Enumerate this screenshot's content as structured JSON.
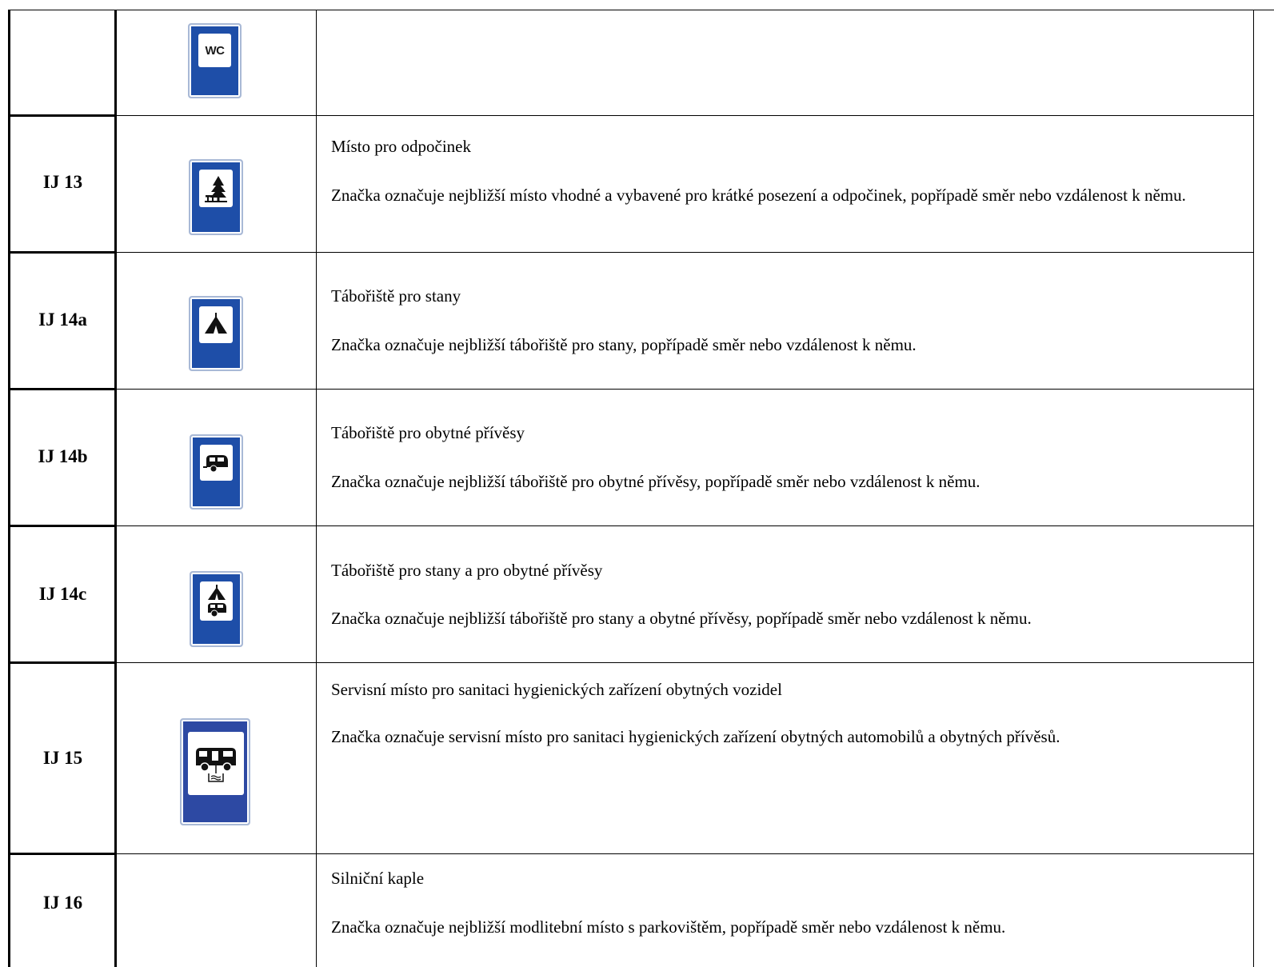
{
  "rows": [
    {
      "code": "",
      "sign_icon": "wc-icon",
      "sign_text": "WC",
      "title": "",
      "description": ""
    },
    {
      "code": "IJ 13",
      "sign_icon": "rest-area-icon",
      "title": "Místo pro odpočinek",
      "description": "Značka označuje nejbližší místo vhodné a vybavené pro krátké posezení a odpočinek, popřípadě směr nebo vzdálenost k němu."
    },
    {
      "code": "IJ 14a",
      "sign_icon": "tent-icon",
      "title": "Tábořiště pro stany",
      "description": "Značka označuje nejbližší tábořiště pro stany, popřípadě směr nebo vzdálenost k němu."
    },
    {
      "code": "IJ 14b",
      "sign_icon": "caravan-icon",
      "title": "Tábořiště pro obytné přívěsy",
      "description": "Značka označuje nejbližší tábořiště pro obytné přívěsy, popřípadě směr nebo vzdálenost k němu."
    },
    {
      "code": "IJ 14c",
      "sign_icon": "tent-and-caravan-icon",
      "title": "Tábořiště pro stany a pro obytné přívěsy",
      "description": "Značka označuje nejbližší tábořiště pro stany a obytné přívěsy, popřípadě směr nebo vzdálenost k němu."
    },
    {
      "code": "IJ 15",
      "sign_icon": "camper-sanitation-icon",
      "title": "Servisní místo pro sanitaci hygienických zařízení obytných vozidel",
      "description": "Značka označuje servisní místo pro sanitaci hygienických zařízení obytných automobilů a obytných přívěsů."
    },
    {
      "code": "IJ 16",
      "sign_icon": "",
      "title": "Silniční kaple",
      "description": "Značka označuje nejbližší modlitební místo s parkovištěm, popřípadě směr nebo vzdálenost k němu."
    }
  ],
  "colors": {
    "sign_blue": "#1e4ea8",
    "sign_blue_large": "#2d49a3"
  }
}
